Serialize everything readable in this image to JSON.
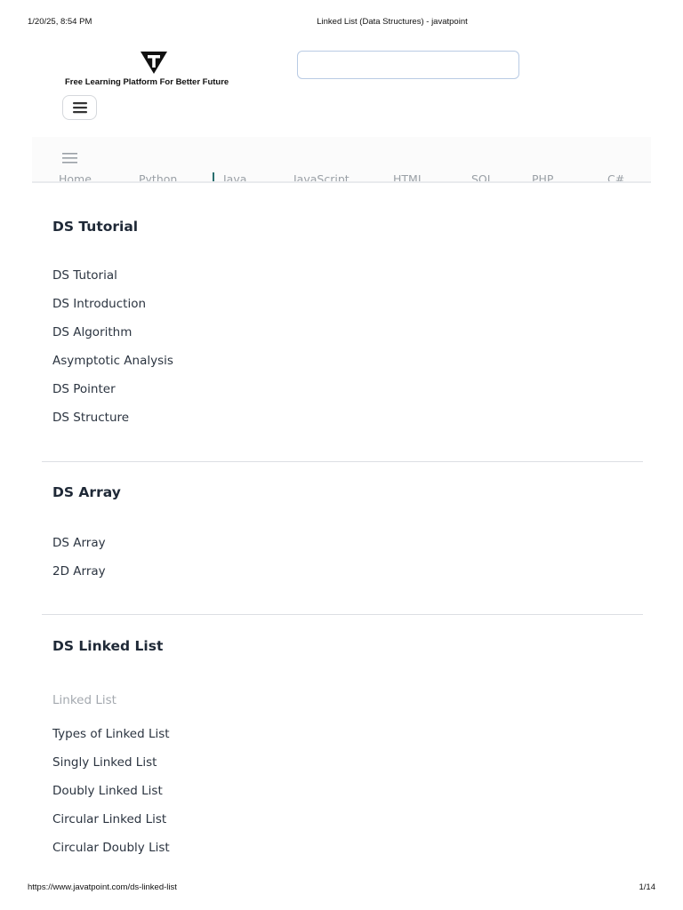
{
  "print_header": {
    "datetime": "1/20/25, 8:54 PM",
    "title": "Linked List (Data Structures) - javatpoint"
  },
  "site": {
    "tagline": "Free Learning Platform For Better Future",
    "search_placeholder": ""
  },
  "nav": {
    "items": [
      "Home",
      "Python",
      "Java",
      "JavaScript",
      "HTML",
      "SQL",
      "PHP",
      "C#"
    ]
  },
  "sections": [
    {
      "title": "DS Tutorial",
      "links": [
        "DS Tutorial",
        "DS Introduction",
        "DS Algorithm",
        "Asymptotic Analysis",
        "DS Pointer",
        "DS Structure"
      ]
    },
    {
      "title": "DS Array",
      "links": [
        "DS Array",
        "2D Array"
      ]
    },
    {
      "title": "DS Linked List",
      "active_link": "Linked List",
      "links": [
        "Types of Linked List",
        "Singly Linked List",
        "Doubly Linked List",
        "Circular Linked List",
        "Circular Doubly List"
      ]
    }
  ],
  "print_footer": {
    "url": "https://www.javatpoint.com/ds-linked-list",
    "page": "1/14"
  },
  "colors": {
    "accent_border": "#b9cbe4",
    "active_link": "#a4a9af",
    "text": "#1f2937"
  }
}
